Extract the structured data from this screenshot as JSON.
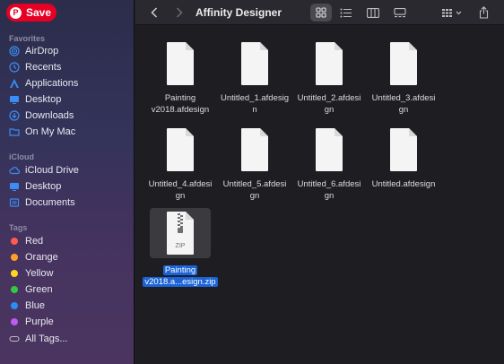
{
  "pinterest": {
    "save_label": "Save",
    "pin_glyph": "P",
    "brand_color": "#e60023"
  },
  "sidebar": {
    "favorites_label": "Favorites",
    "favorites": [
      {
        "label": "AirDrop",
        "icon": "airdrop-icon"
      },
      {
        "label": "Recents",
        "icon": "clock-icon"
      },
      {
        "label": "Applications",
        "icon": "applications-icon"
      },
      {
        "label": "Desktop",
        "icon": "desktop-icon"
      },
      {
        "label": "Downloads",
        "icon": "downloads-icon"
      },
      {
        "label": "On My Mac",
        "icon": "folder-icon"
      }
    ],
    "icloud_label": "iCloud",
    "icloud": [
      {
        "label": "iCloud Drive",
        "icon": "cloud-icon"
      },
      {
        "label": "Desktop",
        "icon": "desktop-icon"
      },
      {
        "label": "Documents",
        "icon": "document-icon"
      }
    ],
    "tags_label": "Tags",
    "tags": [
      {
        "label": "Red",
        "color": "#ff5a52"
      },
      {
        "label": "Orange",
        "color": "#ffa02b"
      },
      {
        "label": "Yellow",
        "color": "#ffd426"
      },
      {
        "label": "Green",
        "color": "#33c748"
      },
      {
        "label": "Blue",
        "color": "#2e8cf0"
      },
      {
        "label": "Purple",
        "color": "#bf5af2"
      },
      {
        "label": "All Tags...",
        "color": ""
      }
    ]
  },
  "toolbar": {
    "title": "Affinity Designer",
    "accent": "#4a4950"
  },
  "files": [
    {
      "name": "Painting v2018.afdesign",
      "line1": "Painting",
      "line2": "v2018.afdesign"
    },
    {
      "name": "Untitled_1.afdesign",
      "line1": "Untitled_1.afdesig",
      "line2": "n"
    },
    {
      "name": "Untitled_2.afdesign",
      "line1": "Untitled_2.afdesi",
      "line2": "gn"
    },
    {
      "name": "Untitled_3.afdesign",
      "line1": "Untitled_3.afdesi",
      "line2": "gn"
    },
    {
      "name": "Untitled_4.afdesign",
      "line1": "Untitled_4.afdesi",
      "line2": "gn"
    },
    {
      "name": "Untitled_5.afdesign",
      "line1": "Untitled_5.afdesi",
      "line2": "gn"
    },
    {
      "name": "Untitled_6.afdesign",
      "line1": "Untitled_6.afdesi",
      "line2": "gn"
    },
    {
      "name": "Untitled.afdesign",
      "line1": "Untitled.afdesign",
      "line2": ""
    }
  ],
  "zip_file": {
    "line1": "Painting",
    "line2": "v2018.a...esign.zip",
    "badge": "ZIP",
    "selection_color": "#1b63d6"
  }
}
